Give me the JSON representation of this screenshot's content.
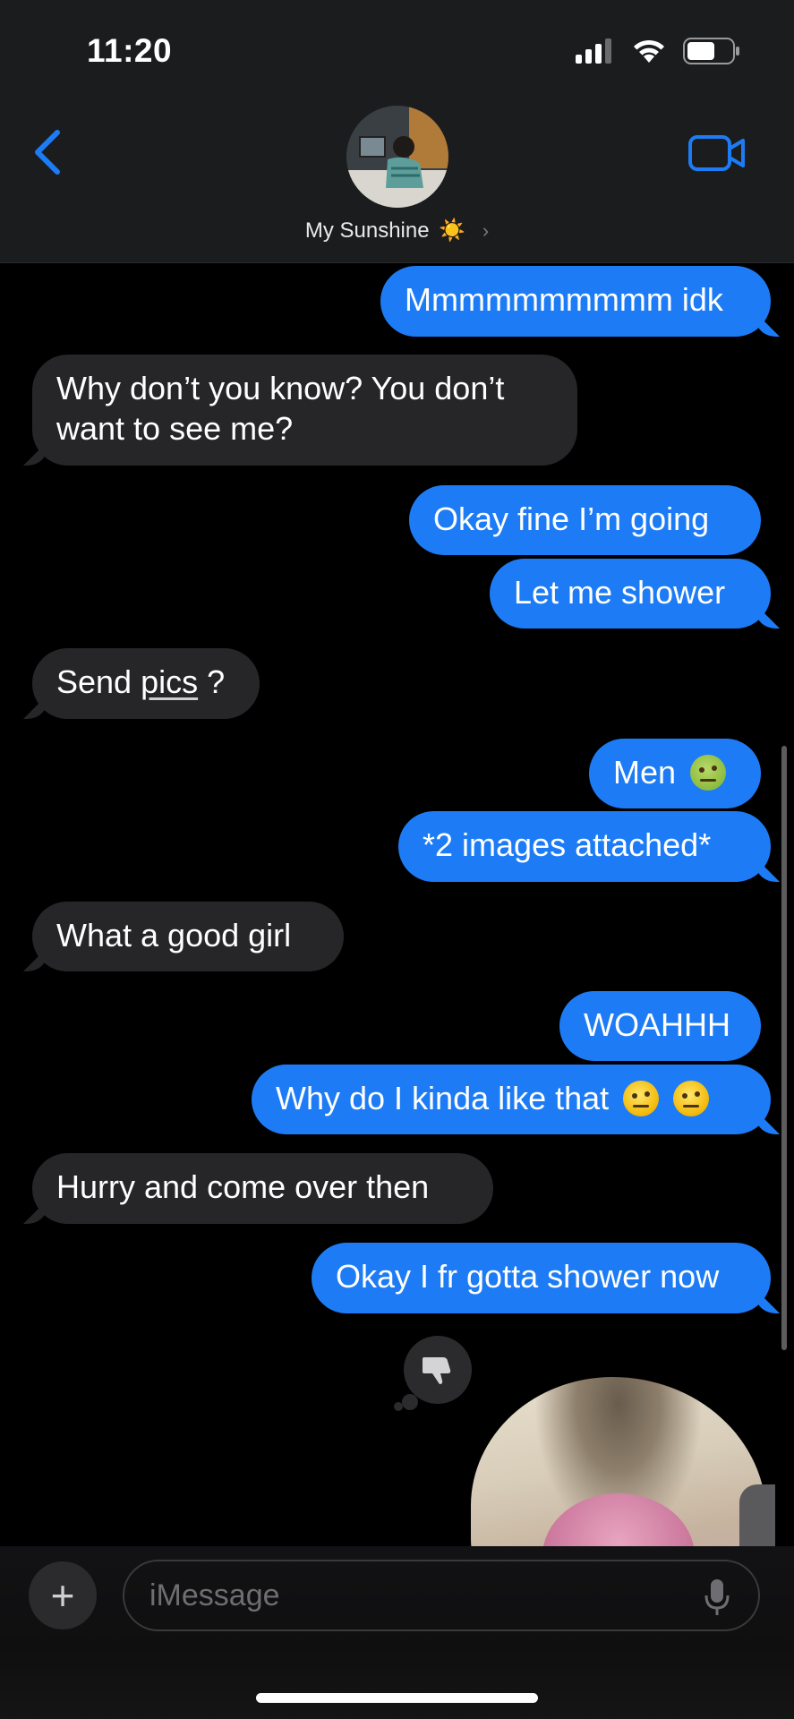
{
  "status_bar": {
    "time": "11:20"
  },
  "header": {
    "contact_name": "My Sunshine",
    "contact_emoji": "☀️",
    "back_icon": "chevron-left-icon",
    "video_icon": "video-camera-icon"
  },
  "messages": [
    {
      "from": "me",
      "text": "Mmmmmmmmmm idk"
    },
    {
      "from": "them",
      "line1": "Why don’t you know? You don’t",
      "line2": "want to see me?"
    },
    {
      "from": "me",
      "text": "Okay fine I’m going"
    },
    {
      "from": "me",
      "text": "Let me shower"
    },
    {
      "from": "them",
      "text_a": "Send ",
      "text_link": "pics",
      "text_b": " ?"
    },
    {
      "from": "me",
      "text": "Men",
      "emoji": "nauseated-face"
    },
    {
      "from": "me",
      "text": "*2 images attached*"
    },
    {
      "from": "them",
      "text": "What a good girl"
    },
    {
      "from": "me",
      "text": "WOAHHH"
    },
    {
      "from": "me",
      "text": "Why do I kinda like that",
      "emoji": "face-with-raised-eyebrow"
    },
    {
      "from": "them",
      "text": "Hurry and come over then"
    },
    {
      "from": "me",
      "text": "Okay I fr gotta shower now"
    }
  ],
  "reaction": {
    "icon": "thumbs-down-icon"
  },
  "composer": {
    "placeholder": "iMessage",
    "plus_label": "+"
  },
  "colors": {
    "outgoing": "#1d7cf5",
    "incoming": "#262628",
    "accent": "#1d7cf5"
  }
}
